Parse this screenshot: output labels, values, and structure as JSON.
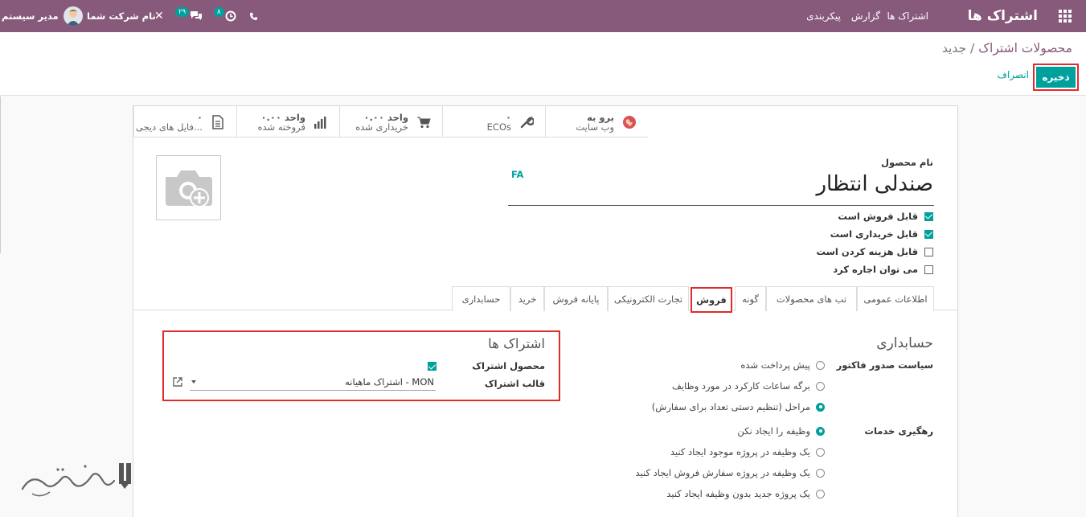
{
  "topbar": {
    "app_name": "اشتراک ها",
    "menu": [
      "اشتراک ها",
      "گزارش",
      "پیکربندی"
    ],
    "user_name": "مدیر سیستم",
    "company_name": "نام شرکت شما",
    "chat_badge": "۲۹",
    "activity_badge": "۸"
  },
  "breadcrumb": {
    "parent": "محصولات اشتراک",
    "separator": "/",
    "current": "جدید"
  },
  "actions": {
    "save": "ذخیره",
    "cancel": "انصراف"
  },
  "smart_buttons": [
    {
      "value": "برو به",
      "label": "وب سایت",
      "icon": "globe-icon"
    },
    {
      "value": "۰",
      "label": "ECOs",
      "icon": "wrench-icon"
    },
    {
      "value": "۰.۰۰ واحد",
      "label": "خریداری شده",
      "icon": "cart-icon"
    },
    {
      "value": "۰.۰۰ واحد",
      "label": "فروخته شده",
      "icon": "bar-chart-icon"
    },
    {
      "value": "۰",
      "label": "فایل های دیجی...",
      "icon": "file-icon"
    }
  ],
  "product": {
    "name_label": "نام محصول",
    "name": "صندلی انتظار",
    "lang_tag": "FA"
  },
  "options": [
    {
      "label": "قابل فروش است",
      "checked": true
    },
    {
      "label": "قابل خریداری است",
      "checked": true
    },
    {
      "label": "قابل هزینه کردن است",
      "checked": false
    },
    {
      "label": "می توان اجاره کرد",
      "checked": false
    }
  ],
  "tabs": [
    "اطلاعات عمومی",
    "تب های محصولات",
    "گونه",
    "فروش",
    "تجارت الکترونیکی",
    "پایانه فروش",
    "خرید",
    "حسابداری"
  ],
  "active_tab": "فروش",
  "accounting_section": {
    "title": "حسابداری",
    "invoice_policy_label": "سیاست صدور فاکتور",
    "invoice_policy_options": [
      {
        "label": "پیش پرداخت شده",
        "selected": false
      },
      {
        "label": "برگه ساعات کارکرد در مورد وظایف",
        "selected": false
      },
      {
        "label": "مراحل (تنظیم دستی تعداد برای سفارش)",
        "selected": true
      }
    ],
    "service_tracking_label": "رهگیری خدمات",
    "service_tracking_options": [
      {
        "label": "وظیفه را ایجاد نکن",
        "selected": true
      },
      {
        "label": "یک وظیفه در پروژه موجود ایجاد کنید",
        "selected": false
      },
      {
        "label": "یک وظیفه در پروژه سفارش فروش ایجاد کنید",
        "selected": false
      },
      {
        "label": "یک پروژه جدید بدون وظیفه ایجاد کنید",
        "selected": false
      }
    ]
  },
  "subscription_section": {
    "title": "اشتراک ها",
    "product_label": "محصول اشتراک",
    "product_checked": true,
    "template_label": "قالب اشتراک",
    "template_value": "MON - اشتراک ماهیانه"
  },
  "colors": {
    "brand": "#875a7b",
    "accent": "#00a09d",
    "highlight": "#e02b2b"
  }
}
